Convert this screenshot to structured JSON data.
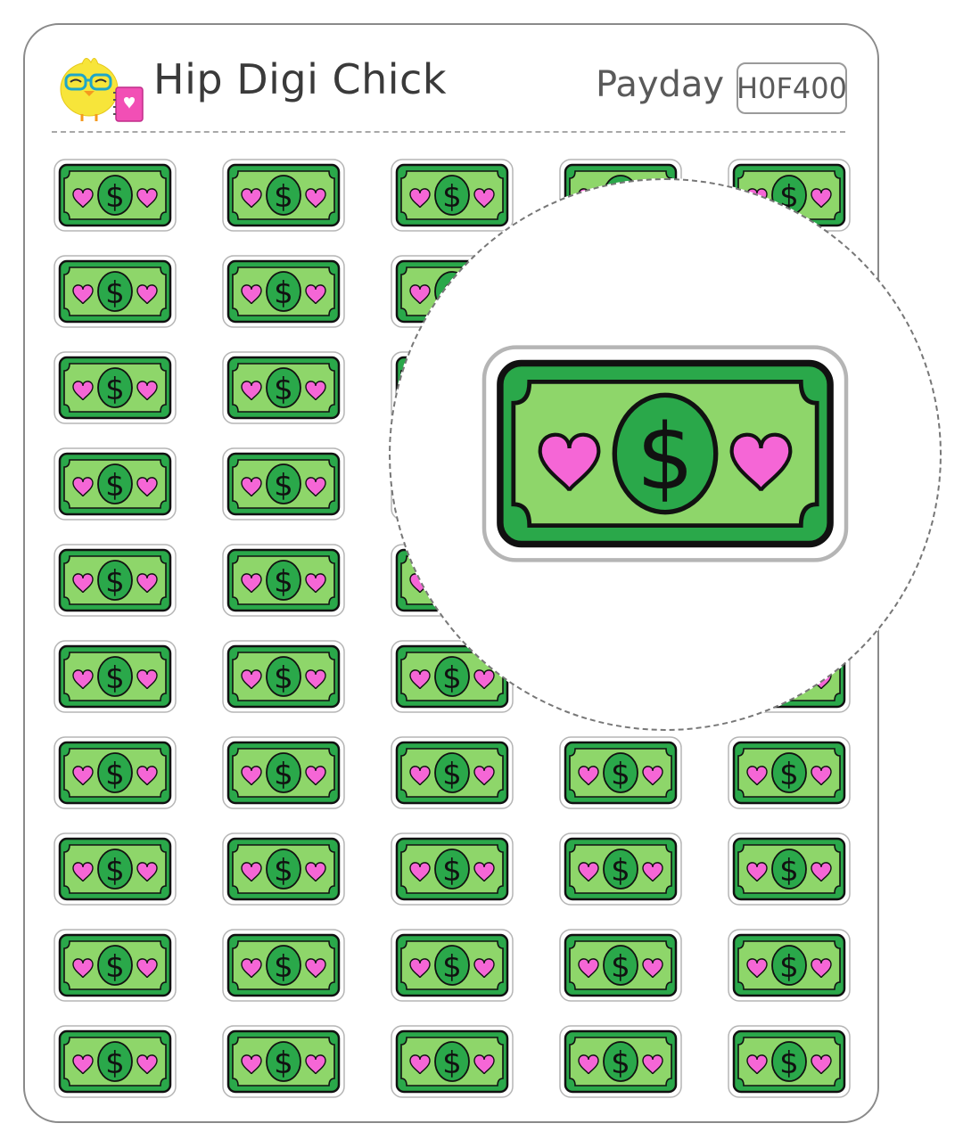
{
  "header": {
    "brand_name": "Hip Digi Chick",
    "sheet_title": "Payday",
    "sku": "H0F400",
    "logo_icon": "chick-with-glasses-and-notebook-icon"
  },
  "sticker": {
    "icon": "dollar-bill-with-hearts-icon",
    "symbol": "$",
    "rows": 10,
    "columns": 5,
    "colors": {
      "bill_dark": "#2aa84a",
      "bill_light": "#8ed66a",
      "heart": "#f566d6",
      "outline": "#111111",
      "cut_border": "#b5b5b5"
    }
  },
  "magnifier": {
    "icon": "magnified-dollar-bill-icon"
  }
}
